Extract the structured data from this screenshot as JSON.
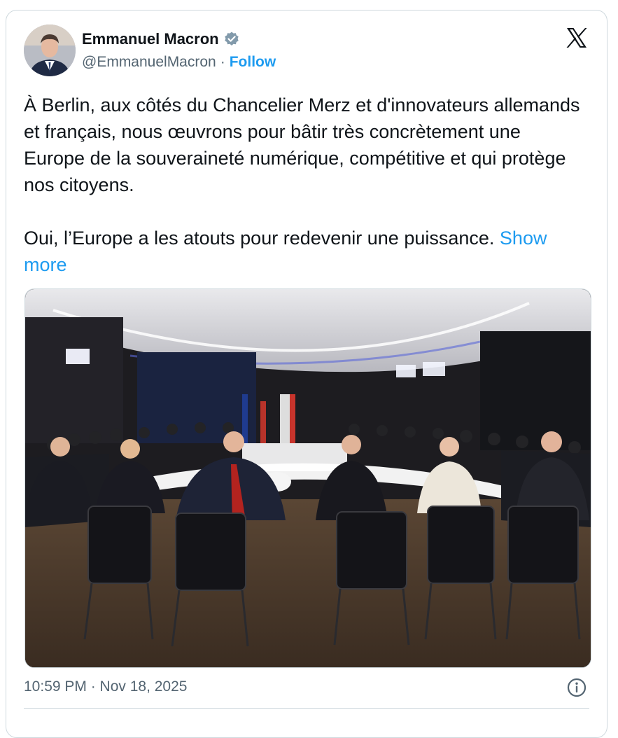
{
  "author": {
    "display_name": "Emmanuel Macron",
    "handle": "@EmmanuelMacron",
    "separator": "·",
    "follow_label": "Follow",
    "verified_icon": "verified-badge-icon"
  },
  "tweet": {
    "paragraph_1": "À Berlin, aux côtés du Chancelier Merz et d'innovateurs allemands et français, nous œuvrons pour bâtir très concrètement une Europe de la souveraineté numérique, compétitive et qui protège nos citoyens.",
    "paragraph_2": "Oui, l’Europe a les atouts pour redevenir une puissance.",
    "show_more_label": "Show more"
  },
  "meta": {
    "timestamp": "10:59 PM · Nov 18, 2025",
    "info_icon": "info-icon"
  },
  "colors": {
    "accent": "#1d9bf0",
    "text": "#0f1419",
    "secondary_text": "#536471",
    "border": "#cfd9de"
  }
}
